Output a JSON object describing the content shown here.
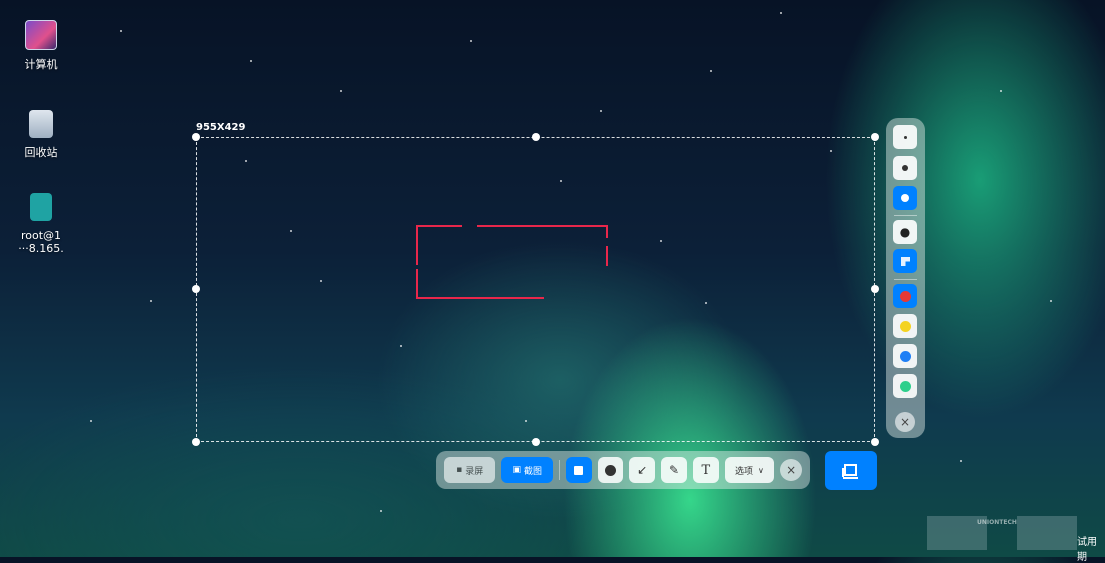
{
  "desktop": {
    "icons": [
      {
        "name": "computer",
        "label": "计算机"
      },
      {
        "name": "trash",
        "label": "回收站"
      },
      {
        "name": "terminal",
        "label": "root@1\n···8.165."
      }
    ]
  },
  "selection": {
    "size_label": "955X429"
  },
  "toolbar": {
    "record_label": "录屏",
    "screenshot_label": "截图",
    "options_label": "选项",
    "close_label": "×"
  },
  "panel": {
    "colors": [
      "#e53935",
      "#f4d321",
      "#1e7ff5",
      "#2ecf8c"
    ],
    "close_label": "×"
  },
  "watermark": {
    "brand": "UNIONTECH",
    "trial_label": "试用期"
  },
  "colors": {
    "accent": "#0081ff",
    "annotation": "#e8274b"
  }
}
